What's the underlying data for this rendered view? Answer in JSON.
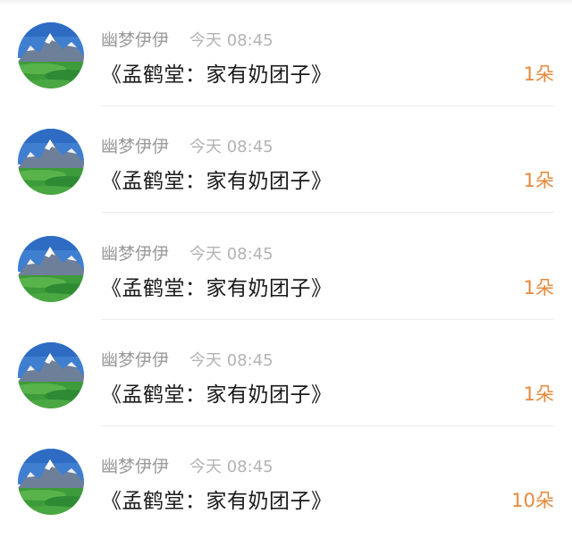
{
  "items": [
    {
      "name": "幽梦伊伊",
      "time": "今天 08:45",
      "title": "《孟鹤堂：家有奶团子》",
      "amount": "1朵"
    },
    {
      "name": "幽梦伊伊",
      "time": "今天 08:45",
      "title": "《孟鹤堂：家有奶团子》",
      "amount": "1朵"
    },
    {
      "name": "幽梦伊伊",
      "time": "今天 08:45",
      "title": "《孟鹤堂：家有奶团子》",
      "amount": "1朵"
    },
    {
      "name": "幽梦伊伊",
      "time": "今天 08:45",
      "title": "《孟鹤堂：家有奶团子》",
      "amount": "1朵"
    },
    {
      "name": "幽梦伊伊",
      "time": "今天 08:45",
      "title": "《孟鹤堂：家有奶团子》",
      "amount": "10朵"
    }
  ],
  "colors": {
    "amount": "#e8893a",
    "name": "#9a9a9a",
    "time": "#b3b3b3",
    "title": "#1a1a1a"
  },
  "avatar_icon": "mountain-landscape-avatar"
}
